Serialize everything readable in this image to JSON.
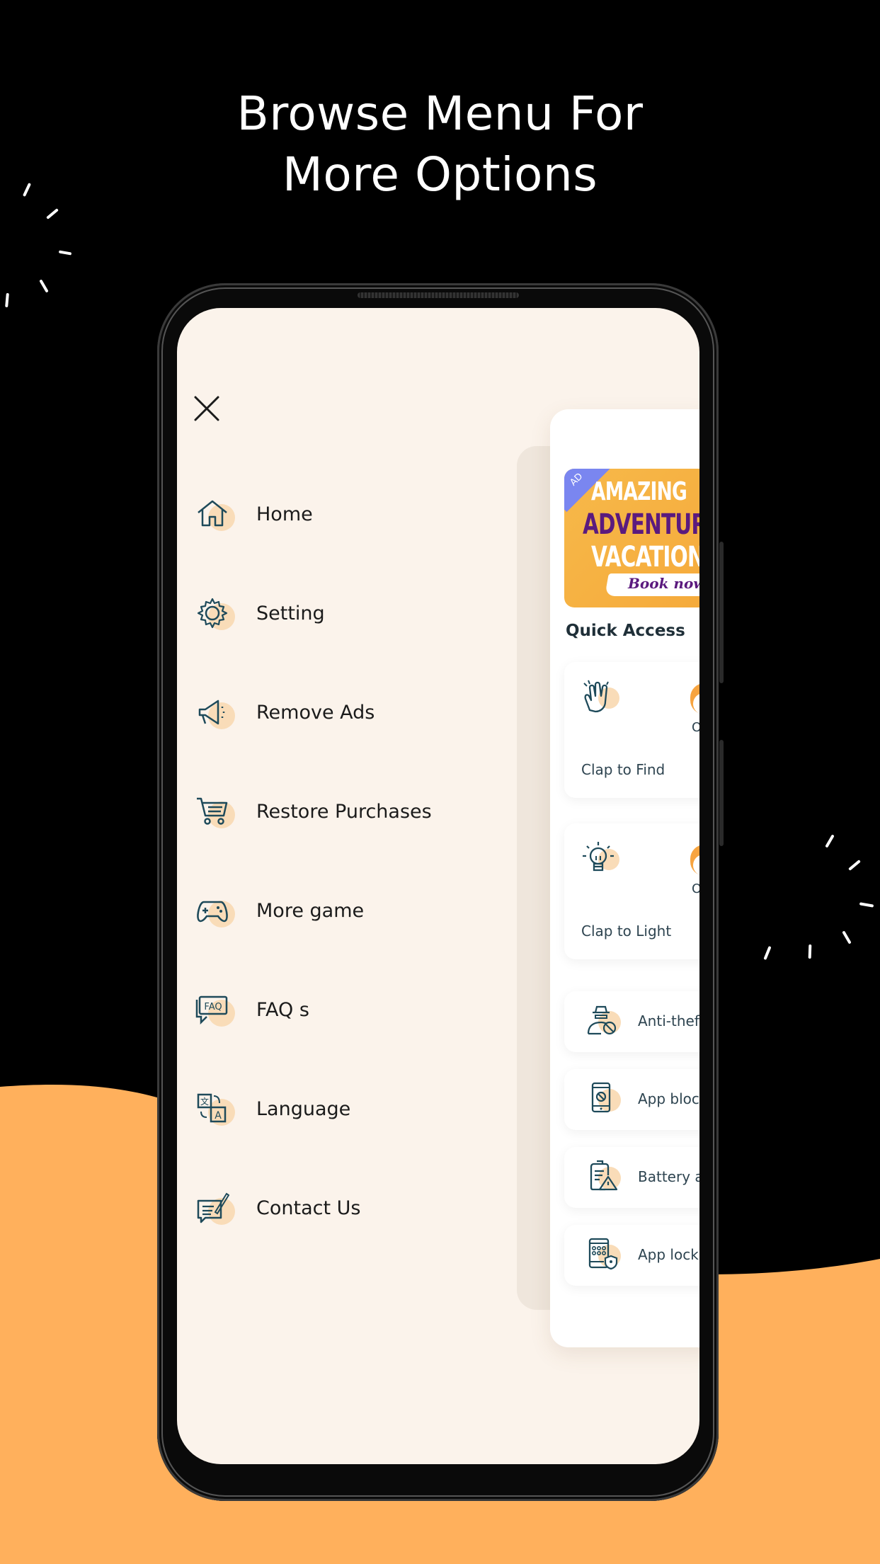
{
  "headline": {
    "line1": "Browse Menu For",
    "line2": "More Options"
  },
  "colors": {
    "background_top": "#000000",
    "background_wave": "#ffb05c",
    "screen_bg": "#fbf3eb",
    "icon_stroke": "#1e4a5a",
    "icon_blob": "#f9dcb8",
    "toggle_on": "#f7a440",
    "ad_badge": "#7a86f0"
  },
  "drawer": {
    "close_icon": "close-icon",
    "items": [
      {
        "label": "Home",
        "icon": "home-icon"
      },
      {
        "label": "Setting",
        "icon": "gear-icon"
      },
      {
        "label": "Remove Ads",
        "icon": "megaphone-icon"
      },
      {
        "label": "Restore Purchases",
        "icon": "cart-icon"
      },
      {
        "label": "More game",
        "icon": "gamepad-icon"
      },
      {
        "label": "FAQ s",
        "icon": "faq-icon"
      },
      {
        "label": "Language",
        "icon": "translate-icon"
      },
      {
        "label": "Contact Us",
        "icon": "contact-icon"
      }
    ]
  },
  "home_panel": {
    "ad": {
      "badge": "AD",
      "line1": "AMAZING",
      "line2": "ADVENTURES",
      "line3": "VACATIONS",
      "cta": "Book now!"
    },
    "quick_access_title": "Quick Access",
    "feature_cards": [
      {
        "label": "Clap to Find",
        "icon": "clap-hands-icon",
        "toggle_label": "O",
        "toggle_on": true
      },
      {
        "label": "Clap to Light",
        "icon": "light-bulb-icon",
        "toggle_label": "O",
        "toggle_on": true
      }
    ],
    "list_rows": [
      {
        "label": "Anti-theft",
        "icon": "thief-icon"
      },
      {
        "label": "App block",
        "icon": "phone-block-icon"
      },
      {
        "label": "Battery alert",
        "icon": "battery-alert-icon"
      },
      {
        "label": "App lock",
        "icon": "app-lock-icon"
      }
    ]
  }
}
